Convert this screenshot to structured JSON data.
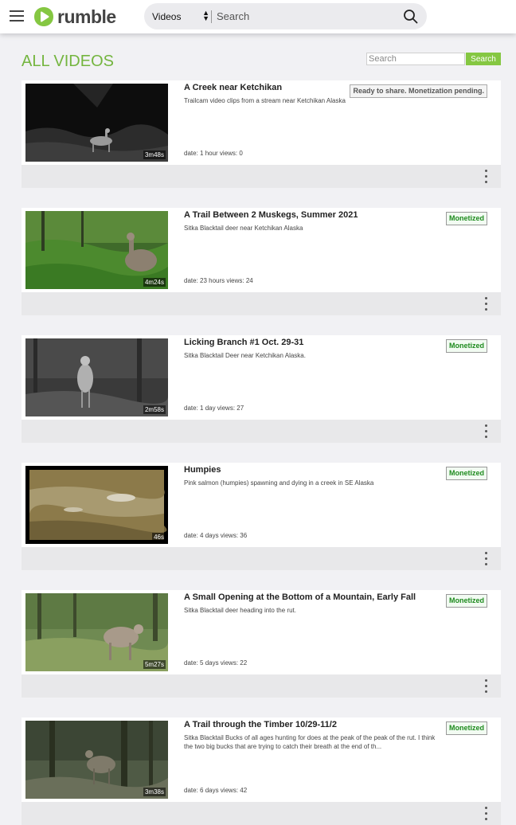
{
  "header": {
    "logo_text": "rumble",
    "search_select_value": "Videos",
    "search_placeholder": "Search"
  },
  "page": {
    "title": "ALL VIDEOS",
    "filter_placeholder": "Search",
    "filter_button": "Search"
  },
  "videos": [
    {
      "title": "A Creek near Ketchikan",
      "description": "Trailcam video clips from a stream near Ketchikan Alaska",
      "duration": "3m48s",
      "meta": "date: 1 hour  views: 0",
      "status": "Ready to share. Monetization pending."
    },
    {
      "title": "A Trail Between 2 Muskegs, Summer 2021",
      "description": "Sitka Blacktail deer near Ketchikan Alaska",
      "duration": "4m24s",
      "meta": "date: 23 hours  views: 24",
      "status": "Monetized"
    },
    {
      "title": "Licking Branch #1 Oct. 29-31",
      "description": "Sitka Blacktail Deer near Ketchikan Alaska.",
      "duration": "2m58s",
      "meta": "date: 1 day  views: 27",
      "status": "Monetized"
    },
    {
      "title": "Humpies",
      "description": "Pink salmon (humpies) spawning and dying in a creek in SE Alaska",
      "duration": "46s",
      "meta": "date: 4 days  views: 36",
      "status": "Monetized"
    },
    {
      "title": "A Small Opening at the Bottom of a Mountain, Early Fall",
      "description": "Sitka Blacktail deer heading into the rut.",
      "duration": "5m27s",
      "meta": "date: 5 days  views: 22",
      "status": "Monetized"
    },
    {
      "title": "A Trail through the Timber 10/29-11/2",
      "description": "Sitka Blacktail Bucks of all ages hunting for does at the peak of the peak of the rut. I think the two big bucks that are trying to catch their breath at the end of th...",
      "duration": "3m38s",
      "meta": "date: 6 days  views: 42",
      "status": "Monetized"
    }
  ],
  "colors": {
    "brand_green": "#85c742",
    "title_green": "#74b53f",
    "monetized_green": "#1d8a1d"
  }
}
